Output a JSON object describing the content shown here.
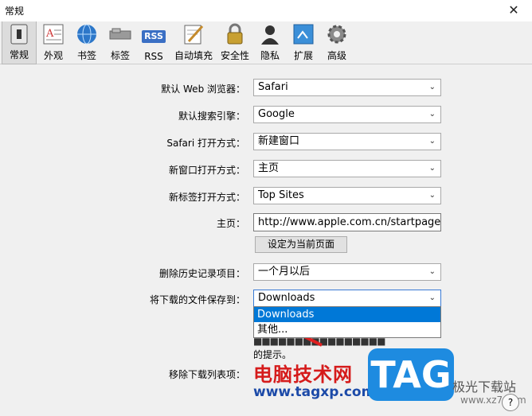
{
  "window": {
    "title": "常规",
    "close": "✕"
  },
  "toolbar": [
    {
      "id": "general",
      "label": "常规",
      "icon": "switch-icon",
      "active": true
    },
    {
      "id": "appearance",
      "label": "外观",
      "icon": "font-appearance-icon",
      "active": false
    },
    {
      "id": "bookmarks",
      "label": "书签",
      "icon": "globe-icon",
      "active": false
    },
    {
      "id": "tabs",
      "label": "标签",
      "icon": "tabs-icon",
      "active": false
    },
    {
      "id": "rss",
      "label": "RSS",
      "icon": "rss-icon",
      "active": false
    },
    {
      "id": "autofill",
      "label": "自动填充",
      "icon": "autofill-pen-icon",
      "active": false
    },
    {
      "id": "security",
      "label": "安全性",
      "icon": "lock-icon",
      "active": false
    },
    {
      "id": "privacy",
      "label": "隐私",
      "icon": "person-silhouette-icon",
      "active": false
    },
    {
      "id": "extensions",
      "label": "扩展",
      "icon": "puzzle-icon",
      "active": false
    },
    {
      "id": "advanced",
      "label": "高级",
      "icon": "gear-icon",
      "active": false
    }
  ],
  "rss_badge": "RSS",
  "form": {
    "default_browser": {
      "label": "默认 Web 浏览器：",
      "value": "Safari"
    },
    "default_search": {
      "label": "默认搜索引擎：",
      "value": "Google"
    },
    "safari_opens_with": {
      "label": "Safari 打开方式：",
      "value": "新建窗口"
    },
    "new_window_opens": {
      "label": "新窗口打开方式：",
      "value": "主页"
    },
    "new_tab_opens": {
      "label": "新标签打开方式：",
      "value": "Top Sites"
    },
    "homepage": {
      "label": "主页：",
      "value": "http://www.apple.com.cn/startpage/"
    },
    "set_current_page_button": "设定为当前页面",
    "remove_history": {
      "label": "删除历史记录项目：",
      "value": "一个月以后"
    },
    "save_downloads_to": {
      "label": "将下载的文件保存到：",
      "value": "Downloads"
    },
    "downloads_options": [
      "Downloads",
      "其他..."
    ],
    "hint_line1": "■■■■■■■■■■■■■■■■",
    "hint_line2": "的提示。",
    "remove_download_list": {
      "label": "移除下载列表项："
    }
  },
  "watermark": {
    "brand_cn": "电脑技术网",
    "url": "www.tagxp.com",
    "tag": "TAG",
    "site_cn": "极光下载站",
    "site_url": "www.xz7.com"
  },
  "help": "?",
  "colors": {
    "selection": "#0078d7",
    "watermark_red": "#d51b1b",
    "tag_blue": "#1e8be0"
  }
}
